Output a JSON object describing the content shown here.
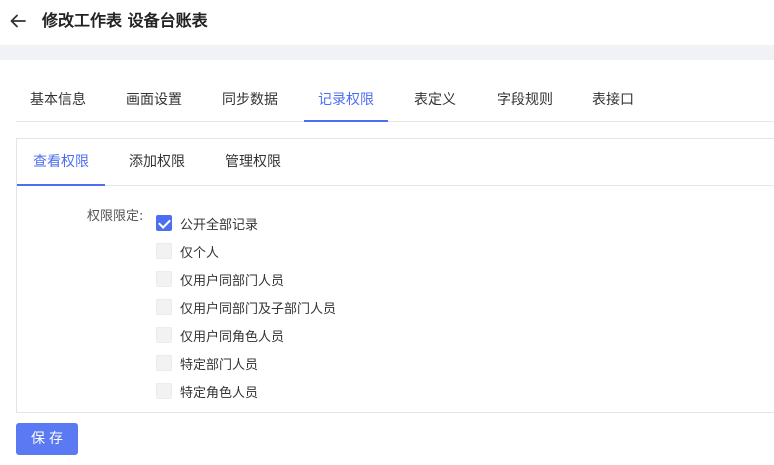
{
  "header": {
    "title": "修改工作表 设备台账表"
  },
  "main_tabs": [
    {
      "label": "基本信息"
    },
    {
      "label": "画面设置"
    },
    {
      "label": "同步数据"
    },
    {
      "label": "记录权限",
      "active": true
    },
    {
      "label": "表定义"
    },
    {
      "label": "字段规则"
    },
    {
      "label": "表接口"
    }
  ],
  "sub_tabs": [
    {
      "label": "查看权限",
      "active": true
    },
    {
      "label": "添加权限"
    },
    {
      "label": "管理权限"
    }
  ],
  "permission": {
    "label": "权限限定:",
    "options": [
      {
        "label": "公开全部记录",
        "checked": true
      },
      {
        "label": "仅个人",
        "checked": false
      },
      {
        "label": "仅用户同部门人员",
        "checked": false
      },
      {
        "label": "仅用户同部门及子部门人员",
        "checked": false
      },
      {
        "label": "仅用户同角色人员",
        "checked": false
      },
      {
        "label": "特定部门人员",
        "checked": false
      },
      {
        "label": "特定角色人员",
        "checked": false
      }
    ]
  },
  "actions": {
    "save_label": "保存"
  },
  "colors": {
    "accent": "#4e6ef2",
    "button": "#5a79f2",
    "band": "#f0f2f5"
  }
}
